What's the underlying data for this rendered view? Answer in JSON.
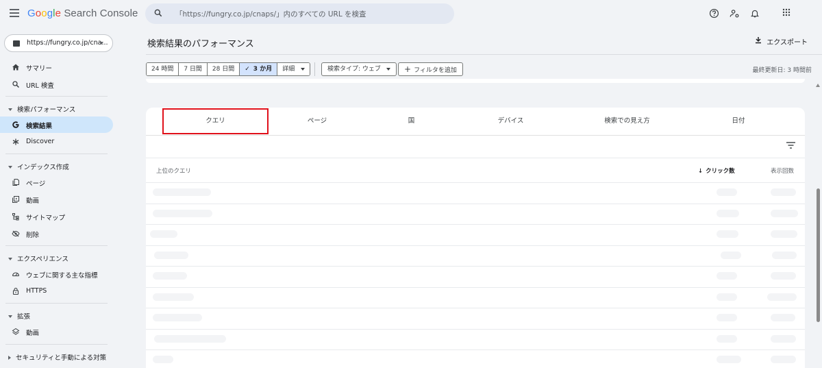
{
  "app": {
    "logo_google": "Google",
    "logo_product": "Search Console",
    "search_placeholder": "「https://fungry.co.jp/cnaps/」内のすべての URL を検査"
  },
  "sidebar": {
    "property": "https://fungry.co.jp/cna...",
    "items": [
      {
        "label": "サマリー",
        "icon": "home-icon"
      },
      {
        "label": "URL 検査",
        "icon": "search-icon"
      },
      {
        "label": "検索結果",
        "icon": "google-g-icon",
        "active": true
      },
      {
        "label": "Discover",
        "icon": "asterisk-icon"
      },
      {
        "label": "ページ",
        "icon": "pages-icon"
      },
      {
        "label": "動画",
        "icon": "video-icon"
      },
      {
        "label": "サイトマップ",
        "icon": "sitemap-icon"
      },
      {
        "label": "削除",
        "icon": "eye-off-icon"
      },
      {
        "label": "ウェブに関する主な指標",
        "icon": "gauge-icon"
      },
      {
        "label": "HTTPS",
        "icon": "lock-icon"
      },
      {
        "label": "動画",
        "icon": "layers-icon"
      }
    ],
    "sections": {
      "performance": "検索パフォーマンス",
      "indexing": "インデックス作成",
      "experience": "エクスペリエンス",
      "enhancements": "拡張",
      "security": "セキュリティと手動による対策"
    }
  },
  "header": {
    "title": "検索結果のパフォーマンス",
    "export": "エクスポート"
  },
  "filters": {
    "ranges": [
      "24 時間",
      "7 日間",
      "28 日間",
      "3 か月",
      "詳細"
    ],
    "selected_check": "✓",
    "search_type": "検索タイプ: ウェブ",
    "add_filter": "フィルタを追加",
    "plus": "+",
    "last_updated": "最終更新日: 3 時間前"
  },
  "tabs": [
    "クエリ",
    "ページ",
    "国",
    "デバイス",
    "検索での見え方",
    "日付"
  ],
  "table": {
    "col_query": "上位のクエリ",
    "col_clicks": "クリック数",
    "col_impressions": "表示回数",
    "sort_arrow": "↓"
  },
  "colors": {
    "accent": "#1a73e8",
    "active_nav": "#cfe6fb",
    "selected_chip": "#d3e3fd",
    "highlight_box": "#e0101a"
  }
}
